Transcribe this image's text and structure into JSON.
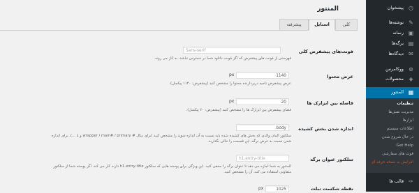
{
  "sidebar": {
    "items": [
      {
        "label": "پیشخوان",
        "icon": "dashboard-icon",
        "glyph": "◷"
      },
      {
        "label": "نوشته‌ها",
        "icon": "pin-icon",
        "glyph": "✎"
      },
      {
        "label": "رسانه",
        "icon": "media-icon",
        "glyph": "▣"
      },
      {
        "label": "برگه‌ها",
        "icon": "pages-icon",
        "glyph": "▤"
      },
      {
        "label": "دیدگاه‌ها",
        "icon": "comments-icon",
        "glyph": "✉"
      },
      {
        "label": "ووکامرس",
        "icon": "woocommerce-icon",
        "glyph": "⊛"
      },
      {
        "label": "محصولات",
        "icon": "products-icon",
        "glyph": "◈"
      },
      {
        "label": "المنتور",
        "icon": "elementor-icon",
        "glyph": "▦"
      },
      {
        "label": "قالب ها",
        "icon": "appearance-icon",
        "glyph": "✑"
      }
    ],
    "submenu": [
      "تنظیمات",
      "مدیریت نقش‌ها",
      "ابزارها",
      "اطلاعات سیستم",
      "در حال شروع شدن",
      "Get Help",
      "قوت های سفارشی",
      "افزایش به نسخه حرفه ای"
    ]
  },
  "page": {
    "title": "المنتور",
    "tabs": [
      "کلی",
      "استایل",
      "پیشرفته"
    ]
  },
  "settings": [
    {
      "label": "فونت‌های پیشفرض کلی",
      "value": "Sans-serif",
      "unit": "",
      "desc": "فهرستی از فونت های پیشفرض که اگر فونت دانلود شما در دسترس نباشد، به کار می روند."
    },
    {
      "label": "عرض محتوا",
      "value": "1140",
      "unit": "px",
      "desc": "عرض پیشفرض ناحیه دربردارنده محتوا را مشخص کنید (پیشفرض: ۱۱۴۰ پیکسل)."
    },
    {
      "label": "فاصله بین ابزارک ها",
      "value": "20",
      "unit": "px",
      "desc": "فضای پیشفرض بین ابزارک ها را مشخص کنید (پیشفرض: ۲۰ پیکسل)."
    },
    {
      "label": "اندازه شدن بخش کشیده",
      "value": "body",
      "unit": "",
      "desc": "سلکتور المان والدی که بخش های کشیده شده باید نسبت به آن اندازه شوند را مشخص کنید (برای مثال # wrapper / main# / primary و یا ...)، برای اندازه",
      "desc2": "شدن نسبت به عرض برگه، این قسمت را خالی بگذارید."
    },
    {
      "label": "سلکتور عنوان برگه",
      "value": "h1.entry-title",
      "unit": "",
      "desc": "المنتور به شما اجازه می دهد تا عنوان برگه را مخفی کنید. این ویژگی برای پوسته هایی که سلکتور h1.entry-title دارند کار می کند. اگر پوسته شما از سلکتور",
      "desc2": "متفاوتی استفاده می کند، آن را مشخص کنید."
    },
    {
      "label": "نقطه شکست تبلت",
      "value": "1025",
      "unit": "px",
      "desc": ""
    }
  ]
}
